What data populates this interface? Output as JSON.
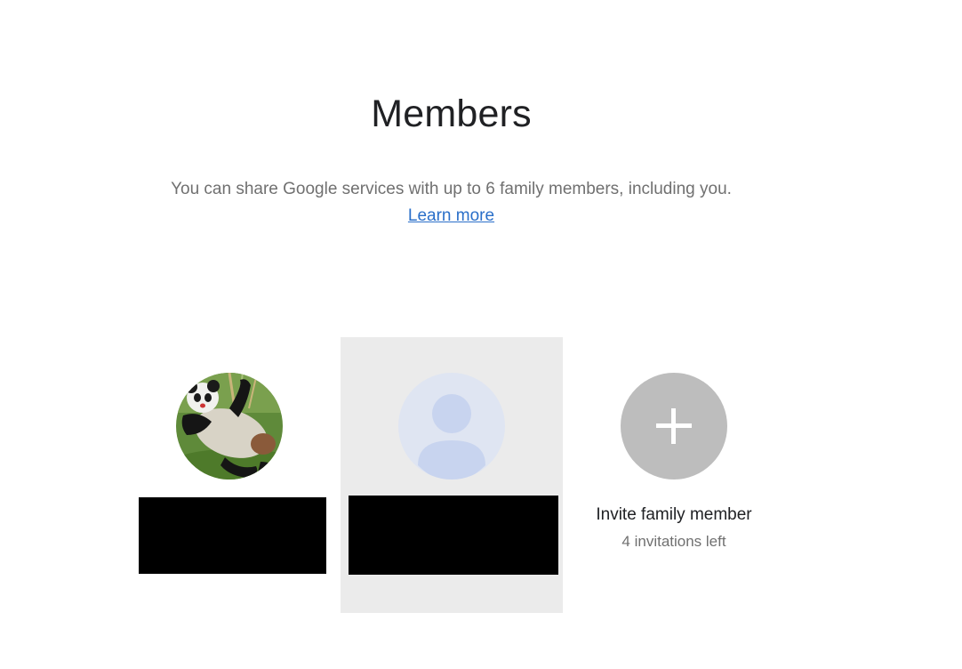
{
  "header": {
    "title": "Members",
    "description": "You can share Google services with up to 6 family members, including you.",
    "learn_more": "Learn more"
  },
  "members": [
    {
      "avatar": "panda-photo-avatar",
      "name_redacted": true
    },
    {
      "avatar": "default-person-avatar",
      "name_redacted": true,
      "selected": true
    }
  ],
  "invite": {
    "label": "Invite family member",
    "remaining": "4 invitations left",
    "icon": "plus-icon"
  },
  "colors": {
    "link": "#2a6fc9",
    "selected_card": "#ebebeb",
    "invite_circle": "#bdbdbd",
    "default_avatar_bg": "#dfe5f2",
    "default_avatar_fg": "#c8d4ef"
  }
}
